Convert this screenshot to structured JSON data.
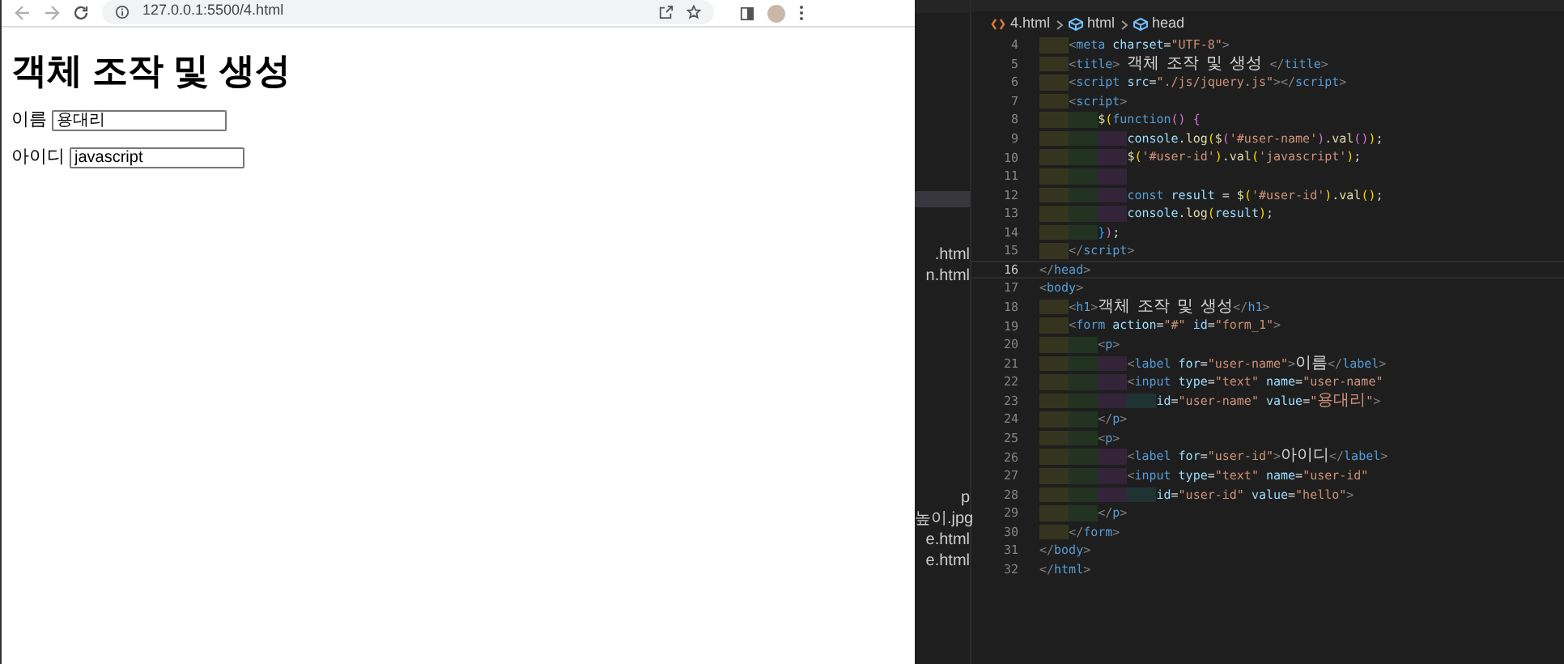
{
  "browser": {
    "url": "127.0.0.1:5500/4.html",
    "heading": "객체 조작 및 생성",
    "fields": [
      {
        "label": "이름",
        "value": "용대리"
      },
      {
        "label": "아이디",
        "value": "javascript"
      }
    ]
  },
  "editor": {
    "breadcrumb": [
      "4.html",
      "html",
      "head"
    ],
    "explorer_items": [
      ".html",
      "n.html",
      "p",
      "높이.jpg",
      "e.html",
      "e.html"
    ],
    "lines": [
      {
        "number": "4",
        "current": false,
        "code": "    <meta charset=\"UTF-8\">"
      },
      {
        "number": "5",
        "current": false,
        "code": "    <title> 객체 조작 및 생성 </title>"
      },
      {
        "number": "6",
        "current": false,
        "code": "    <script src=\"./js/jquery.js\"></script>"
      },
      {
        "number": "7",
        "current": false,
        "code": "    <script>"
      },
      {
        "number": "8",
        "current": false,
        "code": "        $(function() {"
      },
      {
        "number": "9",
        "current": false,
        "code": "            console.log($('#user-name').val());"
      },
      {
        "number": "10",
        "current": false,
        "code": "            $('#user-id').val('javascript');"
      },
      {
        "number": "11",
        "current": false
      },
      {
        "number": "12",
        "current": false,
        "code": "            const result = $('#user-id').val();"
      },
      {
        "number": "13",
        "current": false,
        "code": "            console.log(result);"
      },
      {
        "number": "14",
        "current": false,
        "code": "        });"
      },
      {
        "number": "15",
        "current": false,
        "code": "    </script>"
      },
      {
        "number": "16",
        "current": true,
        "code": "</head>"
      },
      {
        "number": "17",
        "current": false,
        "code": "<body>"
      },
      {
        "number": "18",
        "current": false,
        "code": "    <h1>객체 조작 및 생성</h1>"
      },
      {
        "number": "19",
        "current": false,
        "code": "    <form action=\"#\" id=\"form_1\">"
      },
      {
        "number": "20",
        "current": false,
        "code": "        <p>"
      },
      {
        "number": "21",
        "current": false,
        "code": "            <label for=\"user-name\">이름</label>"
      },
      {
        "number": "22",
        "current": false,
        "code": "            <input type=\"text\" name=\"user-name\""
      },
      {
        "number": "23",
        "current": false,
        "code": "                id=\"user-name\" value=\"용대리\">"
      },
      {
        "number": "24",
        "current": false,
        "code": "        </p>"
      },
      {
        "number": "25",
        "current": false,
        "code": "        <p>"
      },
      {
        "number": "26",
        "current": false,
        "code": "            <label for=\"user-id\">아이디</label>"
      },
      {
        "number": "27",
        "current": false,
        "code": "            <input type=\"text\" name=\"user-id\""
      },
      {
        "number": "28",
        "current": false,
        "code": "                id=\"user-id\" value=\"hello\">"
      },
      {
        "number": "29",
        "current": false,
        "code": "        </p>"
      },
      {
        "number": "30",
        "current": false,
        "code": "    </form>"
      },
      {
        "number": "31",
        "current": false,
        "code": "</body>"
      },
      {
        "number": "32",
        "current": false,
        "code": "</html>"
      }
    ]
  }
}
